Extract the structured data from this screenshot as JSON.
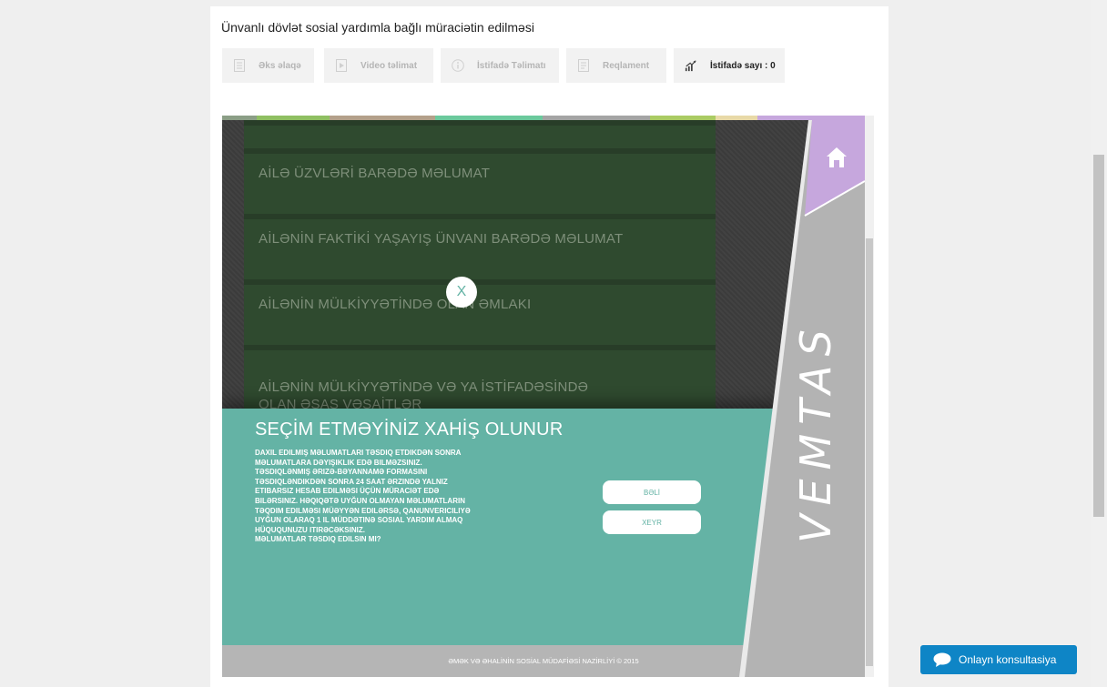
{
  "page": {
    "title": "Ünvanlı dövlət sosial yardımla bağlı müraciətin edilməsi"
  },
  "toolbar": {
    "buttons": [
      {
        "label": "Əks əlaqə",
        "icon": "document-icon"
      },
      {
        "label": "Video təlimat",
        "icon": "video-icon"
      },
      {
        "label": "İstifadə Təlimatı",
        "icon": "info-icon"
      },
      {
        "label": "Reqlament",
        "icon": "list-icon"
      },
      {
        "label": "İstifadə sayı : 0",
        "icon": "chart-growth-icon"
      }
    ]
  },
  "app": {
    "sections": [
      "AİLƏ ÜZVLƏRİ BARƏDƏ MƏLUMAT",
      "AİLƏNİN FAKTİKİ YAŞAYIŞ ÜNVANI BARƏDƏ MƏLUMAT",
      "AİLƏNİN MÜLKİYYƏTİNDƏ OLAN ƏMLAKI",
      "AİLƏNİN MÜLKİYYƏTİNDƏ VƏ YA İSTİFADƏSİNDƏ\nOLAN ƏSAS VƏSAİTLƏR"
    ],
    "brand": "VEMTAS",
    "footer": "ƏMƏK VƏ ƏHALİNİN SOSİAL MÜDAFİƏSİ NAZİRLİYİ © 2015"
  },
  "modal": {
    "title": "SEÇİM ETMƏYİNİZ XAHİŞ OLUNUR",
    "text": "DAXIL EDILMIŞ MƏLUMATLARI TƏSDIQ ETDIKDƏN SONRA\nMƏLUMATLARA DƏYIŞIKLIK EDƏ BILMƏZSINIZ.\nTƏSDIQLƏNMIŞ ƏRIZƏ-BƏYANNAMƏ FORMASINI\nTƏSDIQLƏNDIKDƏN SONRA 24 SAAT ƏRZINDƏ YALNIZ\nETIBARSIZ HESAB EDILMƏSI ÜÇÜN MÜRACIƏT EDƏ\nBILƏRSINIZ. HƏQIQƏTƏ UYĞUN OLMAYAN MƏLUMATLARIN\nTƏQDIM EDILMƏSI MÜƏYYƏN EDILƏRSƏ, QANUNVERICILIYƏ\nUYĞUN OLARAQ 1 IL MÜDDƏTINƏ SOSIAL YARDIM ALMAQ\nHÜQUQUNUZU ITIRƏCƏKSINIZ.\nMƏLUMATLAR TƏSDIQ EDILSIN MI?",
    "close_label": "X",
    "yes_label": "BƏLİ",
    "no_label": "XEYR"
  },
  "chat": {
    "label": "Onlayn konsultasiya"
  },
  "colors": {
    "accent_teal": "#64b3a5",
    "home_lavender": "#c6a7dd",
    "chat_blue": "#0e85c6"
  }
}
